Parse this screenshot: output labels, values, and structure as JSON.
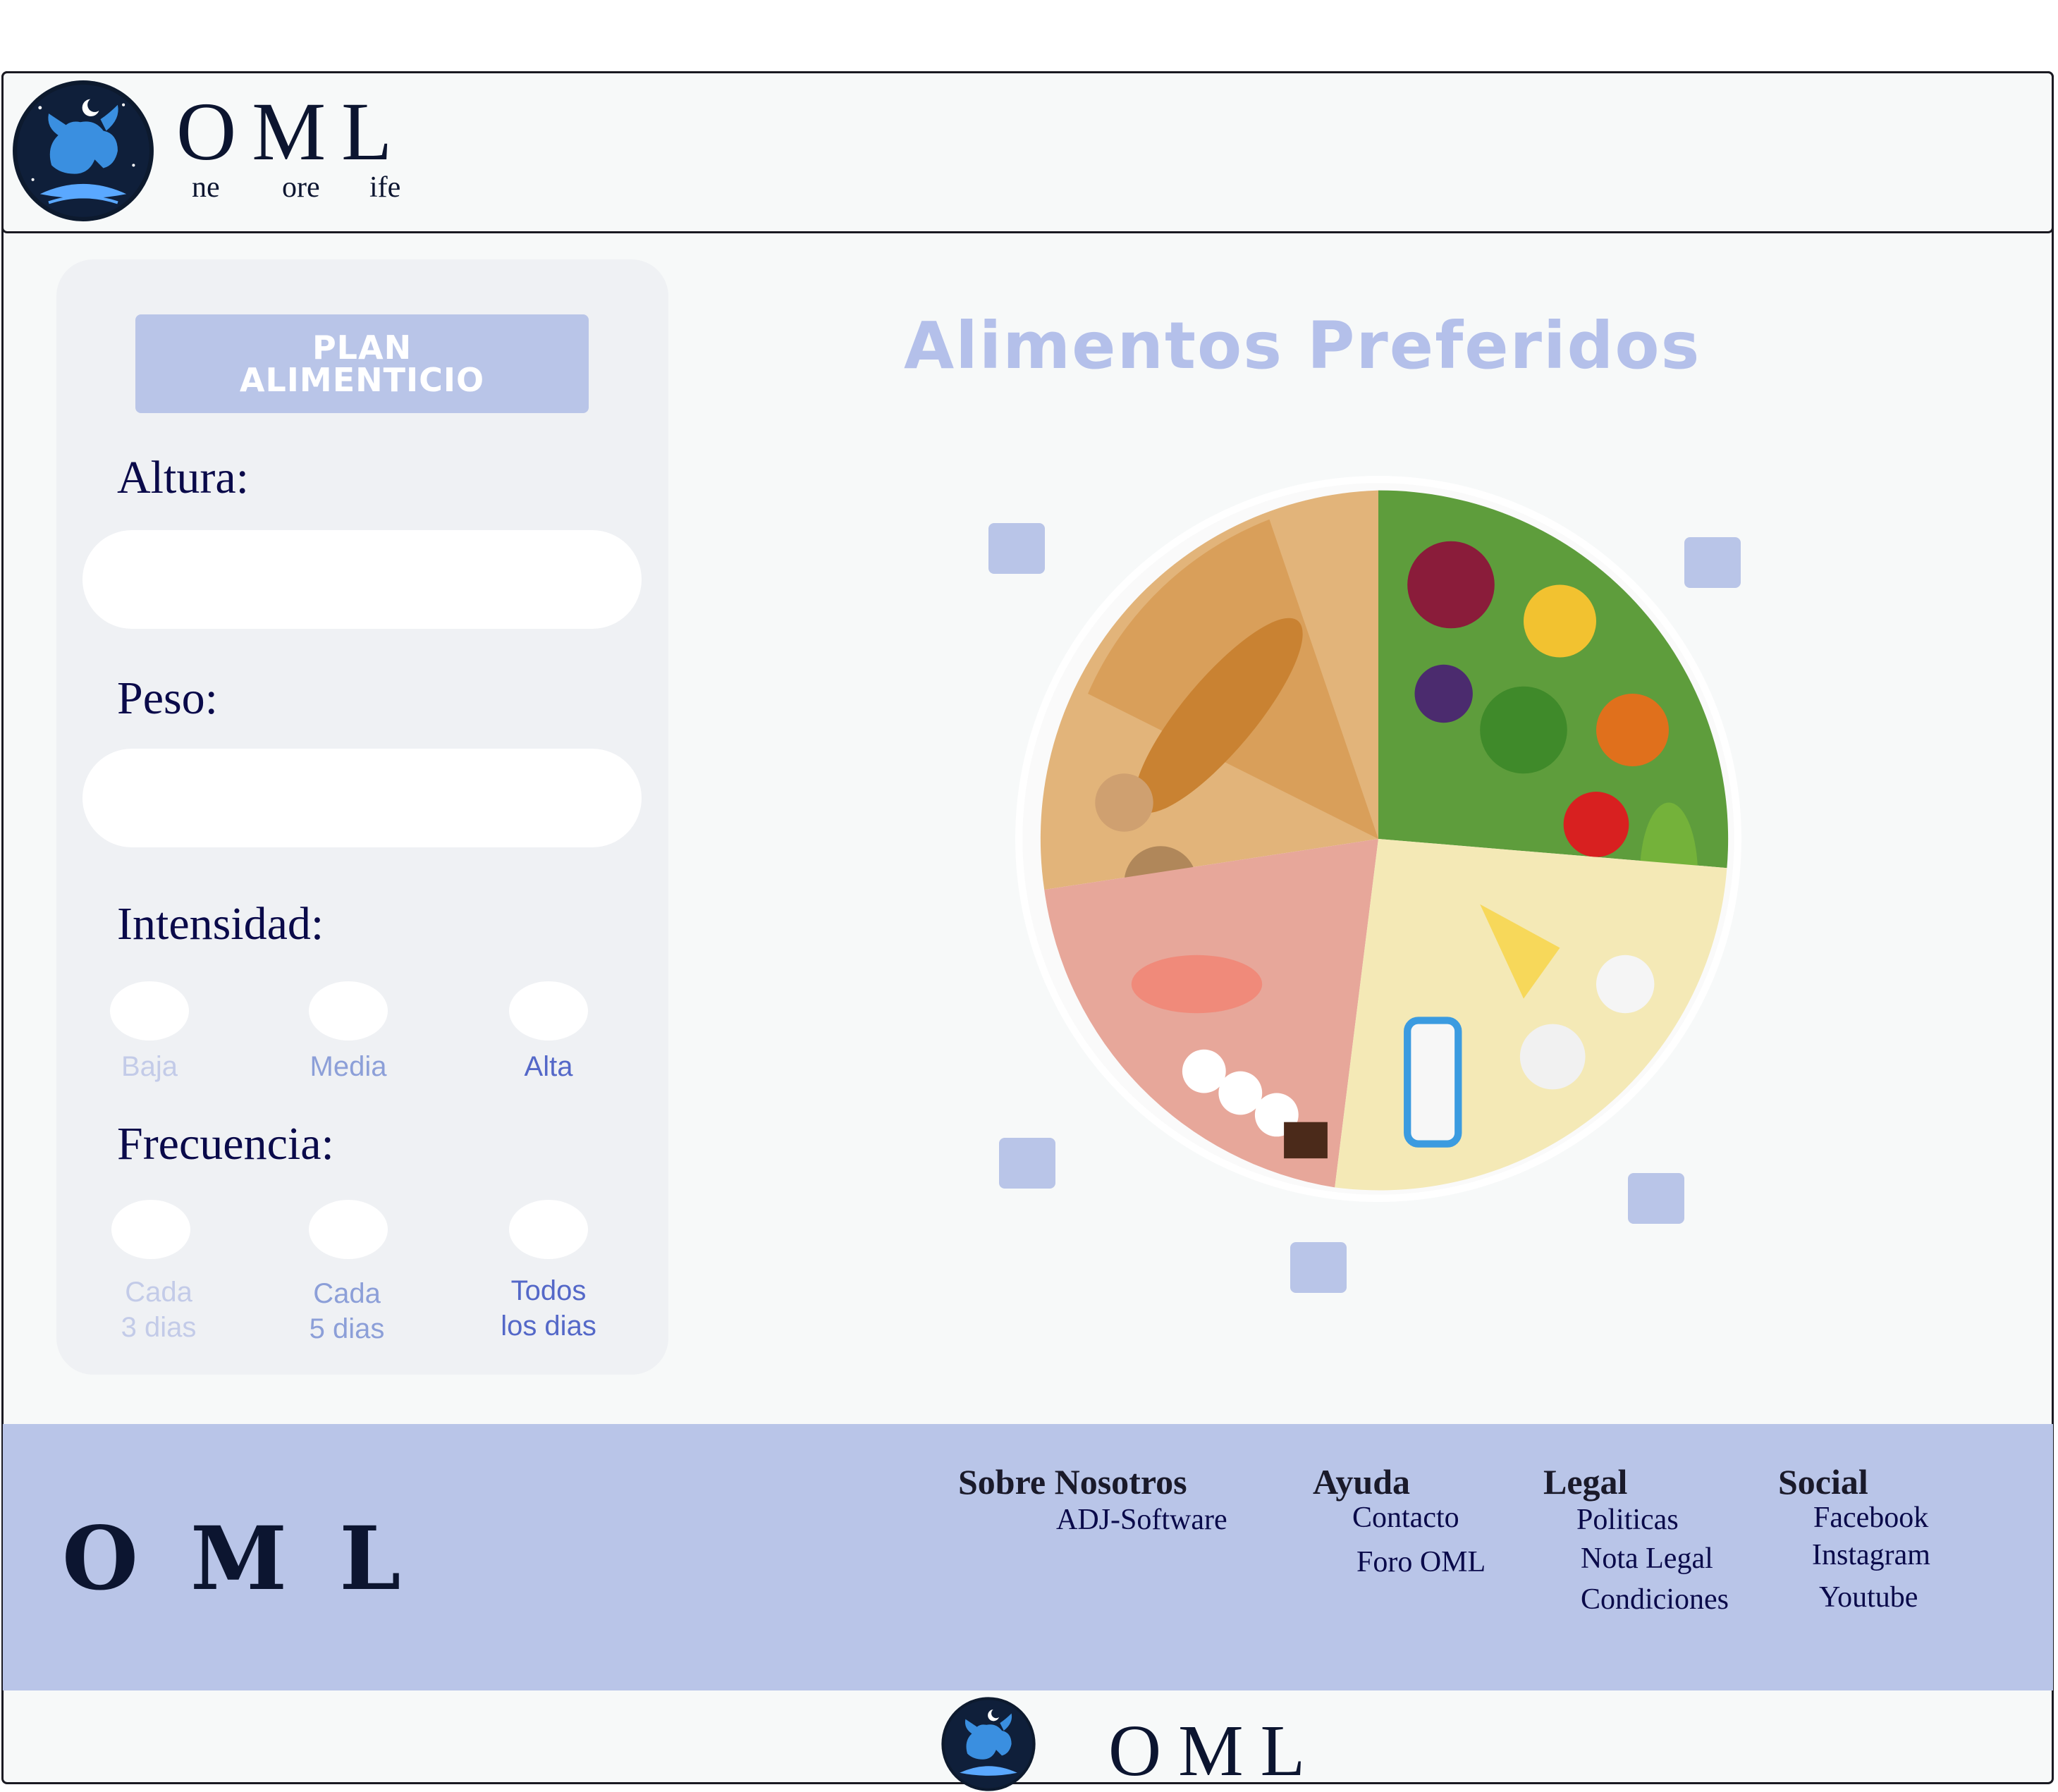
{
  "header": {
    "brand": "OML",
    "sub": [
      "ne",
      "ore",
      "ife"
    ]
  },
  "panel": {
    "plan_button": "PLAN ALIMENTICIO",
    "altura_label": "Altura:",
    "altura_value": "",
    "peso_label": "Peso:",
    "peso_value": "",
    "intensidad_label": "Intensidad:",
    "intensidad_options": [
      {
        "label": "Baja",
        "color": "#c3cbe8"
      },
      {
        "label": "Media",
        "color": "#8c9fd8"
      },
      {
        "label": "Alta",
        "color": "#5468c8"
      }
    ],
    "frecuencia_label": "Frecuencia:",
    "frecuencia_options": [
      {
        "line1": "Cada",
        "line2": "3 dias",
        "color": "#c3cbe8"
      },
      {
        "line1": "Cada",
        "line2": "5 dias",
        "color": "#8c9fd8"
      },
      {
        "line1": "Todos",
        "line2": "los dias",
        "color": "#5468c8"
      }
    ]
  },
  "main": {
    "title": "Alimentos Preferidos"
  },
  "footer": {
    "brand": "OML",
    "columns": [
      {
        "heading": "Sobre Nosotros",
        "links": [
          "ADJ-Software"
        ]
      },
      {
        "heading": "Ayuda",
        "links": [
          "Contacto",
          "Foro OML"
        ]
      },
      {
        "heading": "Legal",
        "links": [
          "Politicas",
          "Nota Legal",
          "Condiciones"
        ]
      },
      {
        "heading": "Social",
        "links": [
          "Facebook",
          "Instagram",
          "Youtube"
        ]
      }
    ]
  },
  "bottom": {
    "brand": "OML"
  },
  "colors": {
    "accent": "#b9c5e8",
    "title": "#b4c0ea",
    "navy": "#0c1530"
  },
  "icons": [
    "oml-logo-icon",
    "food-plate-image"
  ]
}
